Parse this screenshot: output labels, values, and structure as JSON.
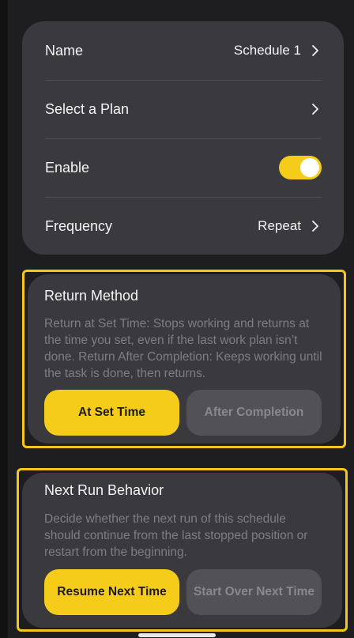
{
  "settings": {
    "name_label": "Name",
    "name_value": "Schedule 1",
    "plan_label": "Select a Plan",
    "enable_label": "Enable",
    "enable_on": true,
    "frequency_label": "Frequency",
    "frequency_value": "Repeat"
  },
  "return_method": {
    "title": "Return Method",
    "description": "Return at Set Time: Stops working and returns at the time you set, even if the last work plan isn’t done. Return After Completion: Keeps working until the task is done, then returns.",
    "option_active": "At Set Time",
    "option_inactive": "After Completion"
  },
  "next_run": {
    "title": "Next Run Behavior",
    "description": "Decide whether the next run of this schedule should continue from the last stopped position or restart from the beginning.",
    "option_active": "Resume Next Time",
    "option_inactive": "Start Over Next Time"
  },
  "colors": {
    "accent": "#f6cc1a",
    "highlight_frame": "#f6c61b",
    "card": "#3a3a3e",
    "background": "#1e1e20"
  }
}
